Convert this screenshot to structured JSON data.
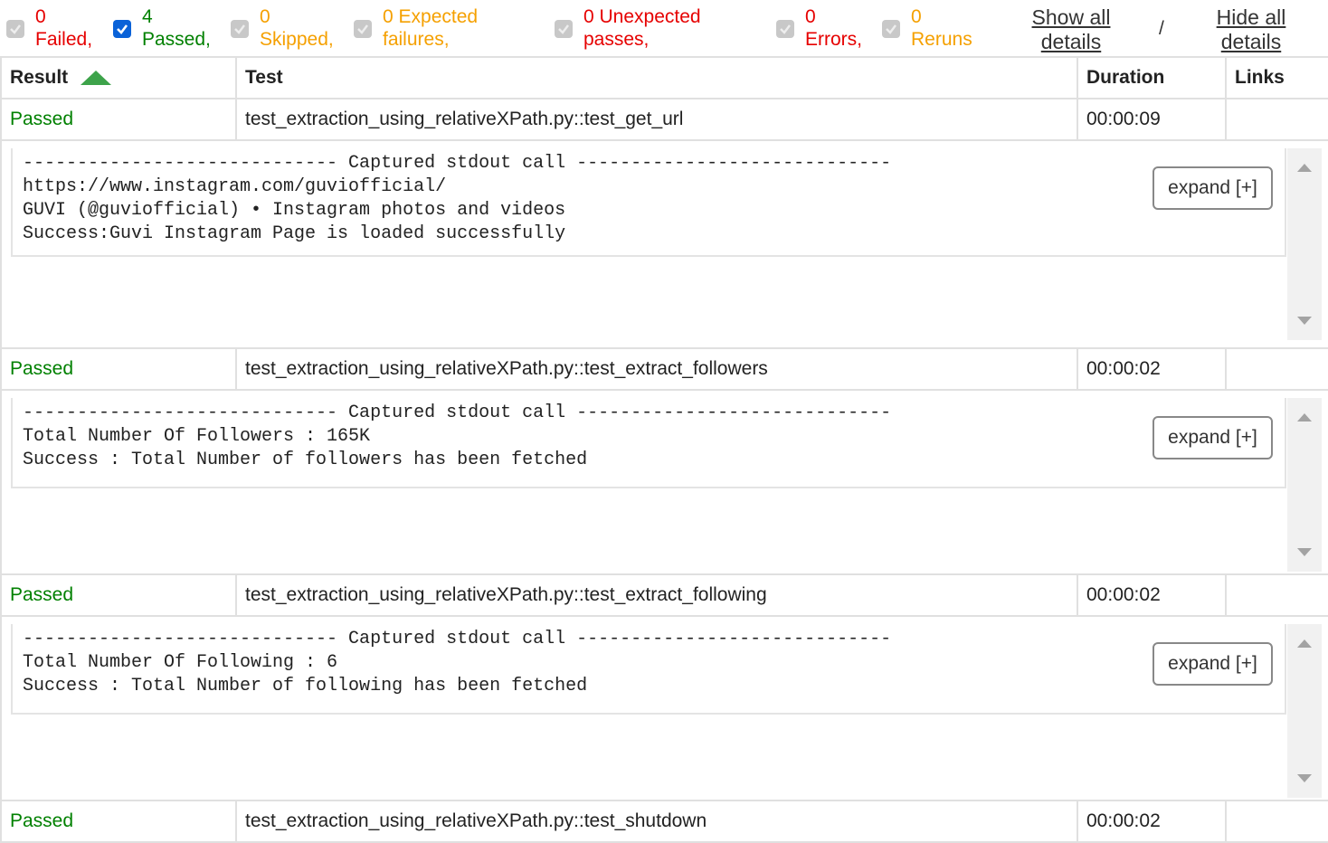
{
  "filters": [
    {
      "count": "0",
      "label": "Failed,",
      "checked": false,
      "color": "#e60000"
    },
    {
      "count": "4",
      "label": "Passed,",
      "checked": true,
      "color": "#008000"
    },
    {
      "count": "0",
      "label": "Skipped,",
      "checked": false,
      "color": "#f5a000"
    },
    {
      "count": "0 Expected",
      "label": "failures,",
      "checked": false,
      "color": "#f5a000"
    },
    {
      "count": "0 Unexpected",
      "label": "passes,",
      "checked": false,
      "color": "#e60000"
    },
    {
      "count": "0",
      "label": "Errors,",
      "checked": false,
      "color": "#e60000"
    },
    {
      "count": "0",
      "label": "Reruns",
      "checked": false,
      "color": "#f5a000"
    }
  ],
  "links": {
    "show_all_1": "Show all",
    "show_all_2": "details",
    "separator": "/",
    "hide_all_1": "Hide all",
    "hide_all_2": "details"
  },
  "table": {
    "headers": {
      "result": "Result",
      "test": "Test",
      "duration": "Duration",
      "links": "Links"
    },
    "rows": [
      {
        "result": "Passed",
        "test": "test_extraction_using_relativeXPath.py::test_get_url",
        "duration": "00:00:09",
        "log": [
          "----------------------------- Captured stdout call -----------------------------",
          "https://www.instagram.com/guviofficial/",
          "GUVI (@guviofficial) • Instagram photos and videos",
          "Success:Guvi Instagram Page is loaded successfully"
        ],
        "expand_label": "expand [+]"
      },
      {
        "result": "Passed",
        "test": "test_extraction_using_relativeXPath.py::test_extract_followers",
        "duration": "00:00:02",
        "log": [
          "----------------------------- Captured stdout call -----------------------------",
          "Total Number Of Followers : 165K",
          "Success : Total Number of followers has been fetched"
        ],
        "expand_label": "expand [+]"
      },
      {
        "result": "Passed",
        "test": "test_extraction_using_relativeXPath.py::test_extract_following",
        "duration": "00:00:02",
        "log": [
          "----------------------------- Captured stdout call -----------------------------",
          "Total Number Of Following : 6",
          "Success : Total Number of following has been fetched"
        ],
        "expand_label": "expand [+]"
      },
      {
        "result": "Passed",
        "test": "test_extraction_using_relativeXPath.py::test_shutdown",
        "duration": "00:00:02"
      }
    ]
  },
  "icons": {
    "sort": "sort-ascending-icon",
    "checkbox": "checkbox-icon"
  }
}
